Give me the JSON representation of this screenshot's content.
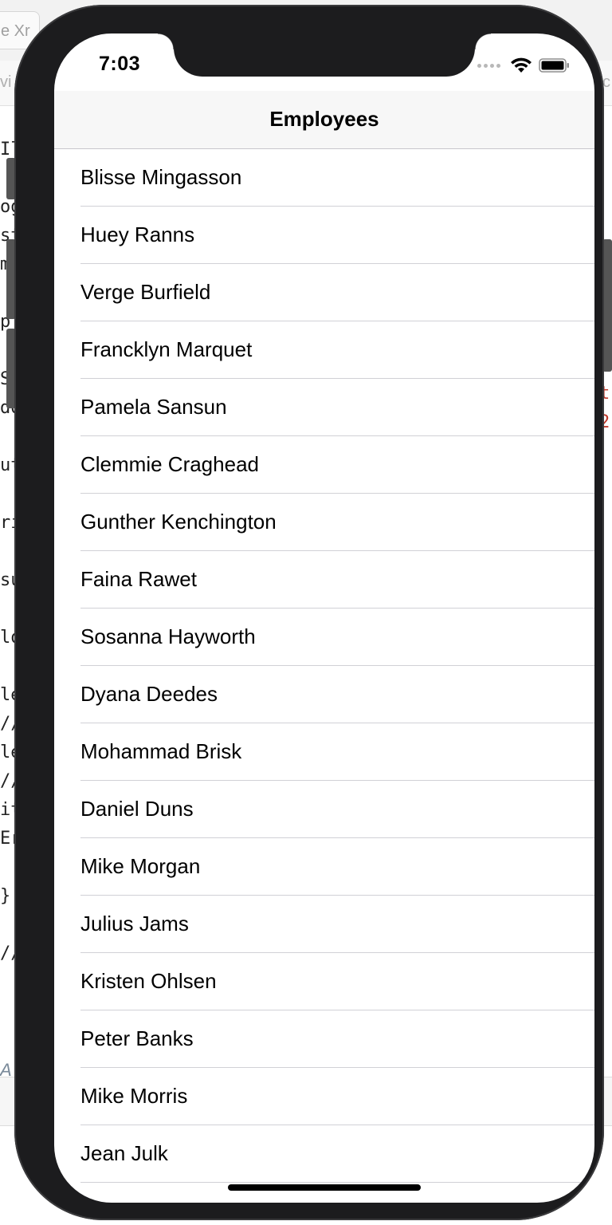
{
  "status_bar": {
    "time": "7:03"
  },
  "nav": {
    "title": "Employees"
  },
  "employees": [
    "Blisse Mingasson",
    "Huey Ranns",
    "Verge Burfield",
    "Francklyn Marquet",
    "Pamela Sansun",
    "Clemmie Craghead",
    "Gunther Kenchington",
    "Faina Rawet",
    "Sosanna Hayworth",
    "Dyana Deedes",
    "Mohammad Brisk",
    "Daniel Duns",
    "Mike Morgan",
    "Julius Jams",
    "Kristen Ohlsen",
    "Peter Banks",
    "Mike Morris",
    "Jean Julk"
  ],
  "background": {
    "tab_label": "e Xr",
    "path_left": "vi",
    "path_right": "c",
    "code_lines": [
      "Il",
      "",
      "og",
      "st",
      "m",
      "",
      "p",
      "",
      "S",
      "do",
      "",
      "ut",
      "",
      "ri",
      "",
      "su",
      "",
      "lo",
      "",
      "le",
      "//",
      "le",
      "//",
      "it",
      "Er",
      "",
      "}",
      "",
      "//"
    ],
    "code_right_lines": [
      "t",
      "2"
    ],
    "bottom_label": "A"
  },
  "colors": {
    "nav_background": "#f7f7f7",
    "separator": "#d1d1d6",
    "phone_frame": "#1c1c1e"
  },
  "icons": {
    "signal": "cellular-signal-icon",
    "wifi": "wifi-icon",
    "battery": "battery-icon"
  }
}
